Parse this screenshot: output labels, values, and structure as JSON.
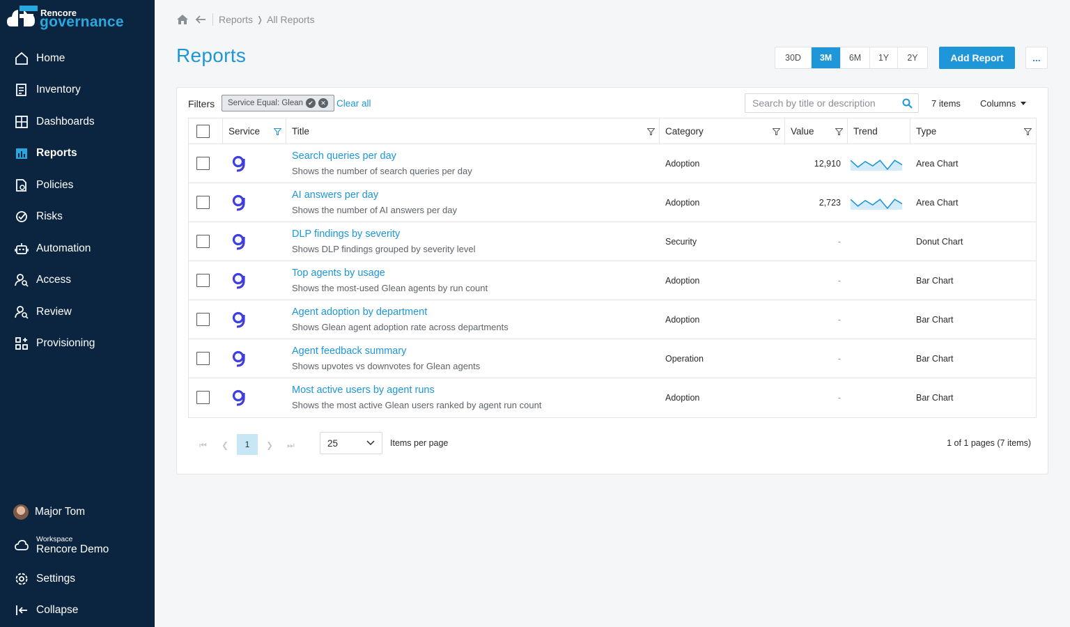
{
  "brand": {
    "line1": "Rencore",
    "line2": "governance"
  },
  "sidebar": {
    "items": [
      {
        "label": "Home",
        "icon": "home-icon",
        "active": false
      },
      {
        "label": "Inventory",
        "icon": "inventory-icon",
        "active": false
      },
      {
        "label": "Dashboards",
        "icon": "dashboards-icon",
        "active": false
      },
      {
        "label": "Reports",
        "icon": "reports-icon",
        "active": true
      },
      {
        "label": "Policies",
        "icon": "policies-icon",
        "active": false
      },
      {
        "label": "Risks",
        "icon": "risks-icon",
        "active": false
      },
      {
        "label": "Automation",
        "icon": "robot-icon",
        "active": false
      },
      {
        "label": "Access",
        "icon": "user-search-icon",
        "active": false
      },
      {
        "label": "Review",
        "icon": "user-search-icon",
        "active": false
      },
      {
        "label": "Provisioning",
        "icon": "provisioning-icon",
        "active": false
      }
    ],
    "user": "Major Tom",
    "workspace_label": "Workspace",
    "workspace_name": "Rencore Demo",
    "settings": "Settings",
    "collapse": "Collapse"
  },
  "breadcrumb": {
    "parent": "Reports",
    "current": "All Reports"
  },
  "page": {
    "title": "Reports"
  },
  "ranges": [
    {
      "label": "30D",
      "active": false
    },
    {
      "label": "3M",
      "active": true
    },
    {
      "label": "6M",
      "active": false
    },
    {
      "label": "1Y",
      "active": false
    },
    {
      "label": "2Y",
      "active": false
    }
  ],
  "toolbar": {
    "add_label": "Add Report",
    "more_label": "..."
  },
  "filters": {
    "label": "Filters",
    "chip": "Service Equal: Glean",
    "clear": "Clear all",
    "search_placeholder": "Search by title or description",
    "count": "7 items",
    "columns": "Columns"
  },
  "table": {
    "headers": [
      "Service",
      "Title",
      "Category",
      "Value",
      "Trend",
      "Type"
    ],
    "rows": [
      {
        "title": "Search queries per day",
        "desc": "Shows the number of search queries per day",
        "category": "Adoption",
        "value": "12,910",
        "trend": [
          0.2,
          0.8,
          0.3,
          0.7,
          0.2,
          1.0,
          0.2,
          0.6
        ],
        "type": "Area Chart"
      },
      {
        "title": "AI answers per day",
        "desc": "Shows the number of AI answers per day",
        "category": "Adoption",
        "value": "2,723",
        "trend": [
          0.2,
          0.8,
          0.3,
          0.7,
          0.2,
          1.0,
          0.2,
          0.6
        ],
        "type": "Area Chart"
      },
      {
        "title": "DLP findings by severity",
        "desc": "Shows DLP findings grouped by severity level",
        "category": "Security",
        "value": "-",
        "trend": null,
        "type": "Donut Chart"
      },
      {
        "title": "Top agents by usage",
        "desc": "Shows the most-used Glean agents by run count",
        "category": "Adoption",
        "value": "-",
        "trend": null,
        "type": "Bar Chart"
      },
      {
        "title": "Agent adoption by department",
        "desc": "Shows Glean agent adoption rate across departments",
        "category": "Adoption",
        "value": "-",
        "trend": null,
        "type": "Bar Chart"
      },
      {
        "title": "Agent feedback summary",
        "desc": "Shows upvotes vs downvotes for Glean agents",
        "category": "Operation",
        "value": "-",
        "trend": null,
        "type": "Bar Chart"
      },
      {
        "title": "Most active users by agent runs",
        "desc": "Shows the most active Glean users ranked by agent run count",
        "category": "Adoption",
        "value": "-",
        "trend": null,
        "type": "Bar Chart"
      }
    ]
  },
  "pager": {
    "page": "1",
    "per_page": "25",
    "per_page_label": "Items per page",
    "info": "1 of 1 pages (7 items)"
  },
  "colors": {
    "accent": "#1e96d7",
    "sidebar": "#0b2540",
    "glean": "#3f3fe0"
  }
}
